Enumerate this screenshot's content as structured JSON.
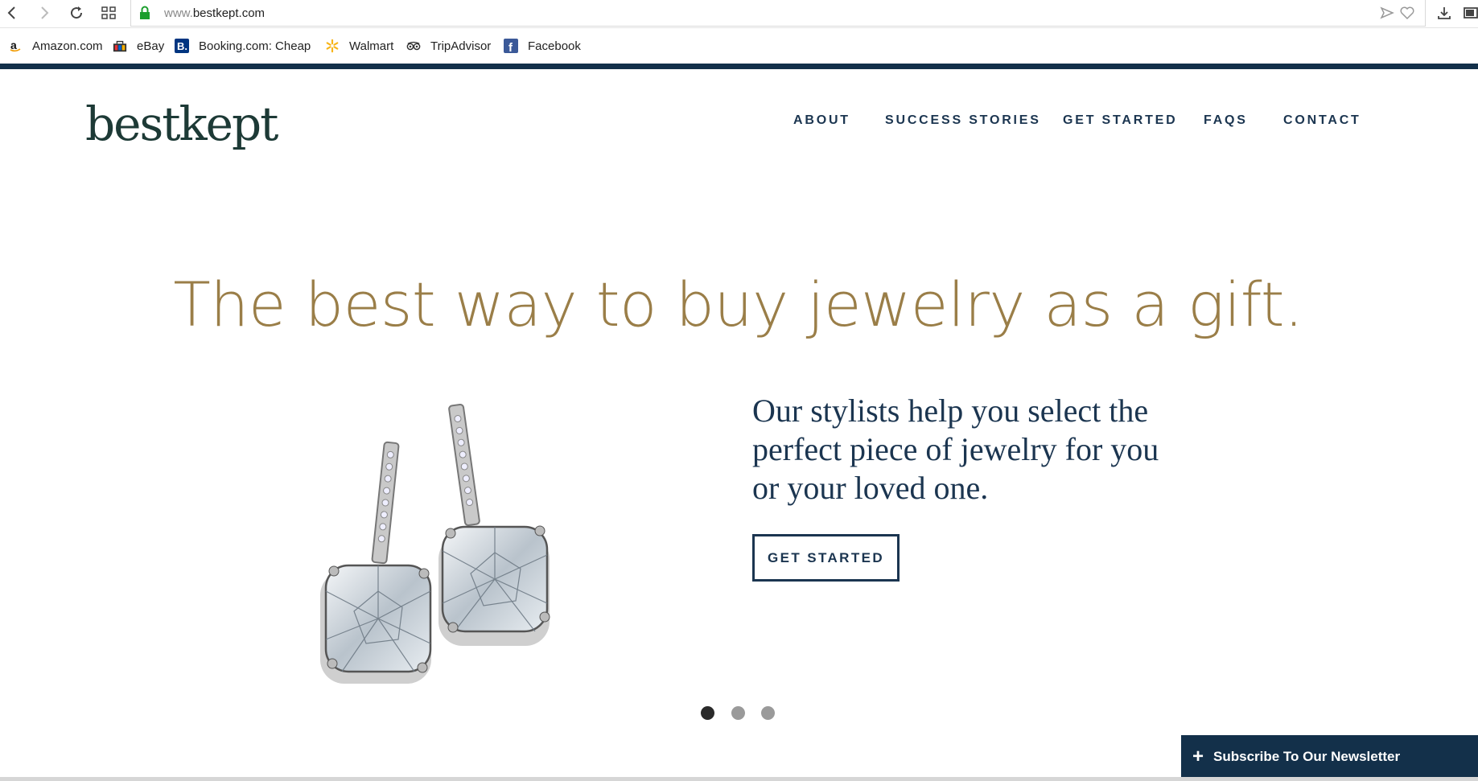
{
  "browser": {
    "url_prefix": "www.",
    "url_domain": "bestkept.com",
    "bookmarks": [
      {
        "label": "Amazon.com",
        "icon": "amazon-icon"
      },
      {
        "label": "eBay",
        "icon": "ebay-icon"
      },
      {
        "label": "Booking.com: Cheap",
        "icon": "booking-icon"
      },
      {
        "label": "Walmart",
        "icon": "walmart-icon"
      },
      {
        "label": "TripAdvisor",
        "icon": "tripadvisor-icon"
      },
      {
        "label": "Facebook",
        "icon": "facebook-icon"
      }
    ]
  },
  "site": {
    "logo": "bestkept",
    "nav": [
      "ABOUT",
      "SUCCESS STORIES",
      "GET STARTED",
      "FAQS",
      "CONTACT"
    ],
    "brand_color": "#13304a",
    "accent_color": "#9a7e48"
  },
  "hero": {
    "title": "The best way to buy jewelry as a gift.",
    "tagline": "Our stylists help you select the perfect piece of jewelry for you or your loved one.",
    "cta": "GET STARTED",
    "slide_count": 3,
    "active_slide": 1
  },
  "newsletter": {
    "label": "Subscribe To Our Newsletter",
    "icon": "plus-icon"
  }
}
